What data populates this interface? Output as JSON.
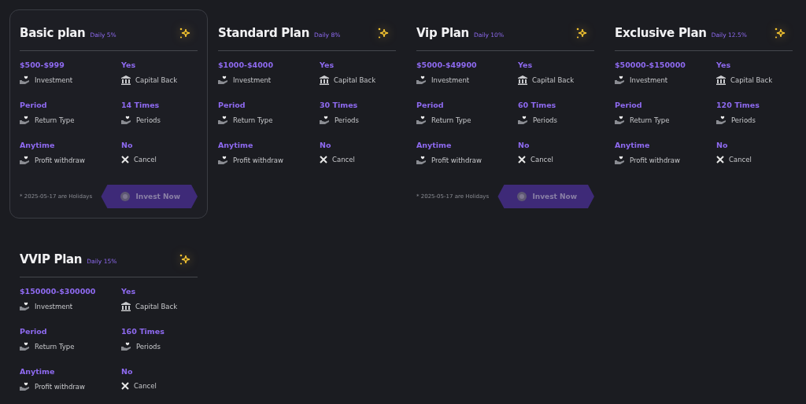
{
  "plans": [
    {
      "title": "Basic plan",
      "daily": "Daily 5%",
      "highlighted": true,
      "cells": [
        {
          "value": "$500-$999",
          "label": "Investment",
          "kind": "hand"
        },
        {
          "value": "Yes",
          "label": "Capital Back",
          "kind": "bank"
        },
        {
          "value": "Period",
          "label": "Return Type",
          "kind": "hand"
        },
        {
          "value": "14 Times",
          "label": "Periods",
          "kind": "hand"
        },
        {
          "value": "Anytime",
          "label": "Profit withdraw",
          "kind": "hand"
        },
        {
          "value": "No",
          "label": "Cancel",
          "kind": "cross"
        }
      ],
      "note": "* 2025-05-17 are Holidays",
      "button": "Invest Now"
    },
    {
      "title": "Standard Plan",
      "daily": "Daily 8%",
      "highlighted": false,
      "cells": [
        {
          "value": "$1000-$4000",
          "label": "Investment",
          "kind": "hand"
        },
        {
          "value": "Yes",
          "label": "Capital Back",
          "kind": "bank"
        },
        {
          "value": "Period",
          "label": "Return Type",
          "kind": "hand"
        },
        {
          "value": "30 Times",
          "label": "Periods",
          "kind": "hand"
        },
        {
          "value": "Anytime",
          "label": "Profit withdraw",
          "kind": "hand"
        },
        {
          "value": "No",
          "label": "Cancel",
          "kind": "cross"
        }
      ]
    },
    {
      "title": "Vip Plan",
      "daily": "Daily 10%",
      "highlighted": false,
      "cells": [
        {
          "value": "$5000-$49900",
          "label": "Investment",
          "kind": "hand"
        },
        {
          "value": "Yes",
          "label": "Capital Back",
          "kind": "bank"
        },
        {
          "value": "Period",
          "label": "Return Type",
          "kind": "hand"
        },
        {
          "value": "60 Times",
          "label": "Periods",
          "kind": "hand"
        },
        {
          "value": "Anytime",
          "label": "Profit withdraw",
          "kind": "hand"
        },
        {
          "value": "No",
          "label": "Cancel",
          "kind": "cross"
        }
      ],
      "note": "* 2025-05-17 are Holidays",
      "button": "Invest Now"
    },
    {
      "title": "Exclusive Plan",
      "daily": "Daily 12.5%",
      "highlighted": false,
      "cells": [
        {
          "value": "$50000-$150000",
          "label": "Investment",
          "kind": "hand"
        },
        {
          "value": "Yes",
          "label": "Capital Back",
          "kind": "bank"
        },
        {
          "value": "Period",
          "label": "Return Type",
          "kind": "hand"
        },
        {
          "value": "120 Times",
          "label": "Periods",
          "kind": "hand"
        },
        {
          "value": "Anytime",
          "label": "Profit withdraw",
          "kind": "hand"
        },
        {
          "value": "No",
          "label": "Cancel",
          "kind": "cross"
        }
      ]
    },
    {
      "title": "VVIP Plan",
      "daily": "Daily 15%",
      "highlighted": false,
      "cells": [
        {
          "value": "$150000-$300000",
          "label": "Investment",
          "kind": "hand"
        },
        {
          "value": "Yes",
          "label": "Capital Back",
          "kind": "bank"
        },
        {
          "value": "Period",
          "label": "Return Type",
          "kind": "hand"
        },
        {
          "value": "160 Times",
          "label": "Periods",
          "kind": "hand"
        },
        {
          "value": "Anytime",
          "label": "Profit withdraw",
          "kind": "hand"
        },
        {
          "value": "No",
          "label": "Cancel",
          "kind": "cross"
        }
      ]
    }
  ]
}
